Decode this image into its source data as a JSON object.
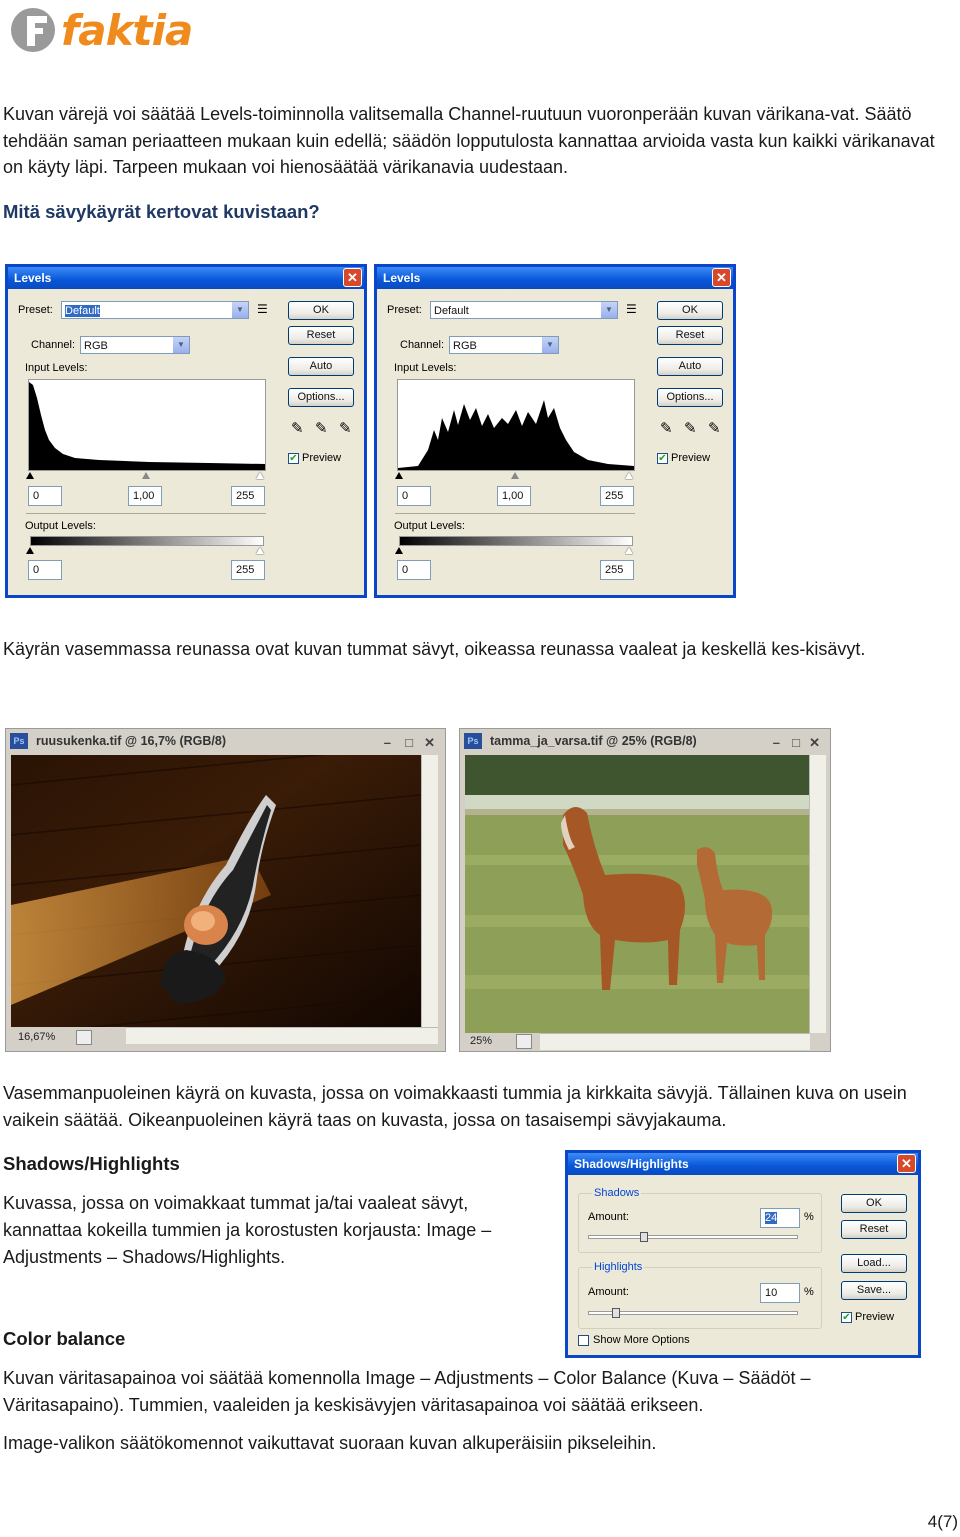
{
  "logo": {
    "text": "faktia"
  },
  "para1": "Kuvan värejä voi säätää Levels-toiminnolla valitsemalla Channel-ruutuun vuoronperään kuvan värikana-vat. Säätö tehdään saman periaatteen mukaan kuin edellä; säädön lopputulosta kannattaa arvioida vasta kun kaikki värikanavat on käyty läpi. Tarpeen mukaan voi hienosäätää värikanavia uudestaan.",
  "heading1": "Mitä sävykäyrät kertovat kuvistaan?",
  "levels_dialogs": [
    {
      "title": "Levels",
      "preset_label": "Preset:",
      "preset_value": "Default",
      "channel_label": "Channel:",
      "channel_value": "RGB",
      "input_levels_label": "Input Levels:",
      "input_values": [
        "0",
        "1,00",
        "255"
      ],
      "output_levels_label": "Output Levels:",
      "output_values": [
        "0",
        "255"
      ],
      "buttons": [
        "OK",
        "Reset",
        "Auto",
        "Options..."
      ],
      "preview_label": "Preview"
    },
    {
      "title": "Levels",
      "preset_label": "Preset:",
      "preset_value": "Default",
      "channel_label": "Channel:",
      "channel_value": "RGB",
      "input_levels_label": "Input Levels:",
      "input_values": [
        "0",
        "1,00",
        "255"
      ],
      "output_levels_label": "Output Levels:",
      "output_values": [
        "0",
        "255"
      ],
      "buttons": [
        "OK",
        "Reset",
        "Auto",
        "Options..."
      ],
      "preview_label": "Preview"
    }
  ],
  "para2": "Käyrän vasemmassa reunassa ovat kuvan tummat sävyt, oikeassa reunassa vaaleat ja keskellä kes-kisävyt.",
  "doc_windows": [
    {
      "title": "ruusukenka.tif @ 16,7% (RGB/8)",
      "zoom": "16,67%"
    },
    {
      "title": "tamma_ja_varsa.tif @ 25% (RGB/8)",
      "zoom": "25%"
    }
  ],
  "para3": "Vasemmanpuoleinen käyrä on kuvasta, jossa on voimakkaasti tummia ja kirkkaita sävyjä. Tällainen kuva on usein vaikein säätää.  Oikeanpuoleinen käyrä taas on kuvasta, jossa on tasaisempi sävyjakauma.",
  "heading2": "Shadows/Highlights",
  "para4": "Kuvassa, jossa on voimakkaat tummat ja/tai vaaleat sävyt, kannattaa kokeilla tummien ja korostusten korjausta: Image – Adjustments – Shadows/Highlights.",
  "sh_dialog": {
    "title": "Shadows/Highlights",
    "shadows_label": "Shadows",
    "highlights_label": "Highlights",
    "amount_label": "Amount:",
    "shadows_amount": "24",
    "highlights_amount": "10",
    "percent": "%",
    "buttons": [
      "OK",
      "Reset",
      "Load...",
      "Save..."
    ],
    "preview_label": "Preview",
    "show_more_label": "Show More Options"
  },
  "heading3": "Color balance",
  "para5": "Kuvan väritasapainoa voi säätää komennolla Image – Adjustments – Color Balance (Kuva – Säädöt – Väritasapaino). Tummien, vaaleiden ja keskisävyjen väritasapainoa voi säätää erikseen.",
  "para6": "Image-valikon säätökomennot vaikuttavat suoraan kuvan alkuperäisiin pikseleihin.",
  "page_number": "4(7)"
}
